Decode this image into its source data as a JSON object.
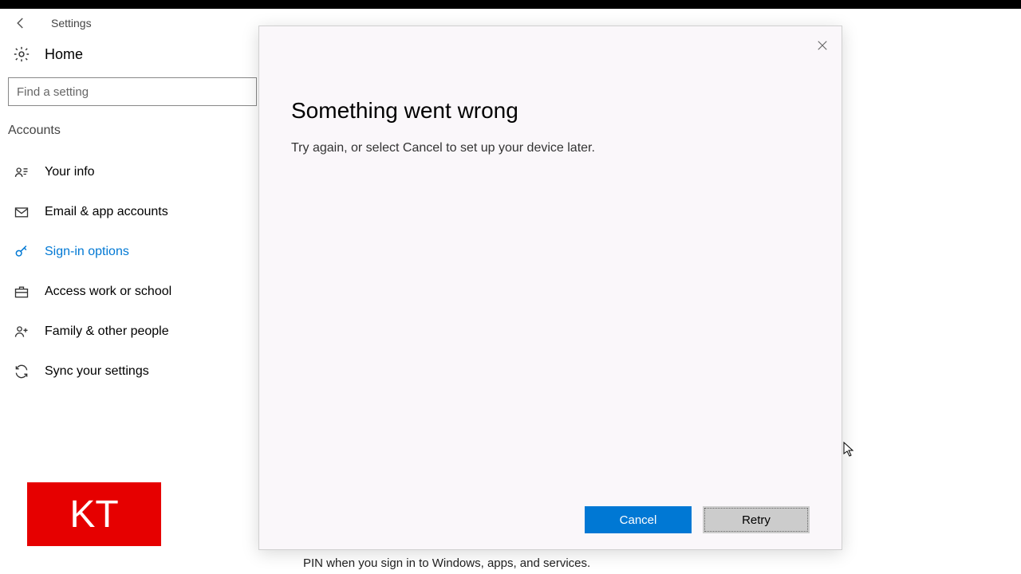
{
  "header": {
    "title": "Settings"
  },
  "home_label": "Home",
  "search": {
    "placeholder": "Find a setting"
  },
  "section_label": "Accounts",
  "nav": [
    {
      "id": "your-info",
      "label": "Your info",
      "selected": false
    },
    {
      "id": "email-accounts",
      "label": "Email & app accounts",
      "selected": false
    },
    {
      "id": "sign-in-options",
      "label": "Sign-in options",
      "selected": true
    },
    {
      "id": "access-work-school",
      "label": "Access work or school",
      "selected": false
    },
    {
      "id": "family-people",
      "label": "Family & other people",
      "selected": false
    },
    {
      "id": "sync-settings",
      "label": "Sync your settings",
      "selected": false
    }
  ],
  "dialog": {
    "title": "Something went wrong",
    "message": "Try again, or select Cancel to set up your device later.",
    "cancel_label": "Cancel",
    "retry_label": "Retry"
  },
  "background_text": "PIN when you sign in to Windows, apps, and services.",
  "logo_text": "KT"
}
